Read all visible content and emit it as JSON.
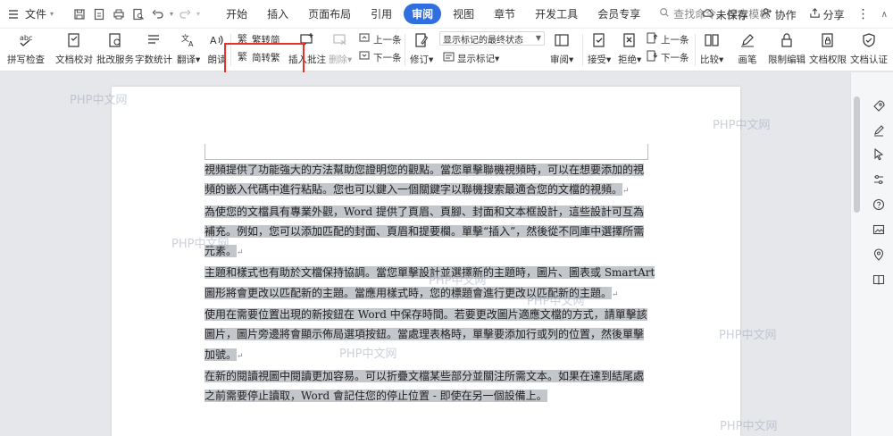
{
  "menubar": {
    "file_label": "文件",
    "tabs": [
      {
        "label": "开始"
      },
      {
        "label": "插入"
      },
      {
        "label": "页面布局"
      },
      {
        "label": "引用"
      },
      {
        "label": "审阅",
        "active": true
      },
      {
        "label": "视图"
      },
      {
        "label": "章节"
      },
      {
        "label": "开发工具"
      },
      {
        "label": "会员专享"
      }
    ],
    "search_placeholder": "查找命令、搜索模板",
    "unsaved": "未保存",
    "collab": "协作",
    "share": "分享"
  },
  "ribbon": {
    "spell_check": "拼写检查",
    "doc_proof": "文档校对",
    "batch_service": "批改服务",
    "word_count": "字数统计",
    "translate": "翻译",
    "read_aloud": "朗读",
    "trad_to_simp": "繁转简",
    "simp_to_trad": "简转繁",
    "insert_comment": "插入批注",
    "delete": "删除",
    "prev_comment": "上一条",
    "next_comment": "下一条",
    "revise": "修订",
    "markup_select": "显示标记的最终状态",
    "show_markup": "显示标记",
    "review": "审阅",
    "accept": "接受",
    "reject": "拒绝",
    "prev_change": "上一条",
    "next_change": "下一条",
    "compare": "比较",
    "pen": "画笔",
    "restrict_edit": "限制编辑",
    "doc_permission": "文档权限",
    "doc_cert": "文档认证"
  },
  "document": {
    "paragraphs": [
      {
        "lines": [
          "視頻提供了功能強大的方法幫助您證明您的觀點。當您單擊聯機視頻時，可以在想要添加的視",
          "頻的嵌入代碼中進行粘貼。您也可以鍵入一個關鍵字以聯機搜索最適合您的文檔的視頻。"
        ]
      },
      {
        "lines": [
          "為使您的文檔具有專業外觀，Word 提供了頁眉、頁腳、封面和文本框設計，這些設計可互為",
          "補充。例如，您可以添加匹配的封面、頁眉和提要欄。單擊“插入”，然後從不同庫中選擇所需",
          "元素。"
        ]
      },
      {
        "lines": [
          "主題和樣式也有助於文檔保持協調。當您單擊設計並選擇新的主題時，圖片、圖表或 SmartArt",
          "圖形將會更改以匹配新的主題。當應用樣式時，您的標題會進行更改以匹配新的主題。"
        ]
      },
      {
        "lines": [
          "使用在需要位置出現的新按鈕在 Word 中保存時間。若要更改圖片適應文檔的方式，請單擊該",
          "圖片，圖片旁邊將會顯示佈局選項按鈕。當處理表格時，單擊要添加行或列的位置，然後單擊",
          "加號。"
        ]
      },
      {
        "lines": [
          "在新的閱讀視圖中閱讀更加容易。可以折疊文檔某些部分並關注所需文本。如果在達到結尾處",
          "之前需要停止讀取，Word 會記住您的停止位置 - 即使在另一個設備上。"
        ]
      }
    ]
  },
  "watermarks": [
    "PHP中文网",
    "PHP中文网",
    "PHP中文网",
    "PHP中文网",
    "PHP中文网",
    "PHP中文网",
    "PHP中文网",
    "PHP中文网"
  ]
}
